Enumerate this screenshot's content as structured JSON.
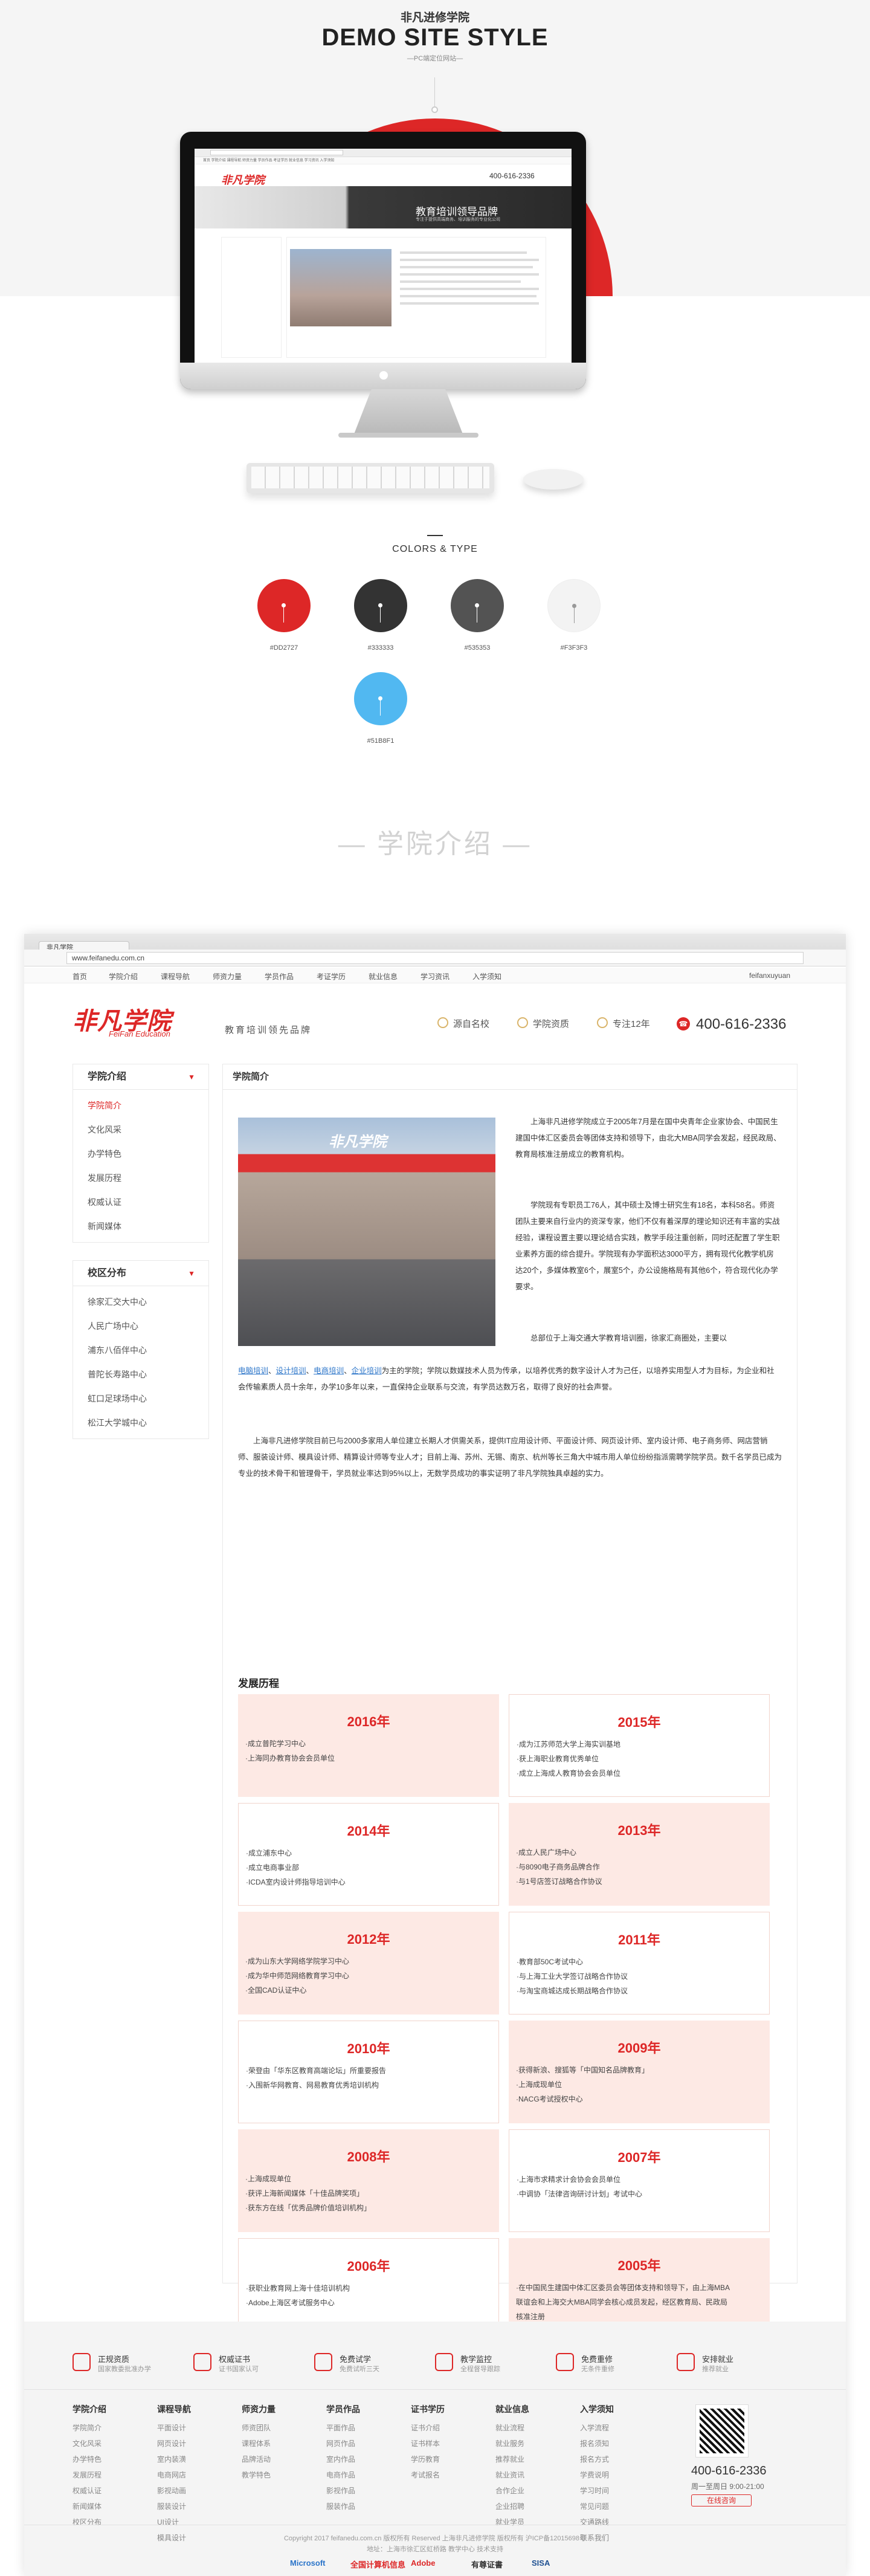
{
  "hero": {
    "subtitle": "非凡进修学院",
    "title": "DEMO SITE STYLE",
    "tag": "—PC端定位网站—"
  },
  "mini_site": {
    "logo": "非凡学院",
    "phone": "400-616-2336",
    "banner_title": "教育培训领导品牌",
    "banner_sub": "专注于提供高端商务、培训服务的专业化公司",
    "nav": "首页   学院介绍   课程导航   师资力量   学员作品   考证学历   就业信息   学习资讯   入学须知"
  },
  "colors": {
    "title": "COLORS & TYPE",
    "items": [
      {
        "hex": "#DD2727",
        "label": "#DD2727"
      },
      {
        "hex": "#333333",
        "label": "#333333"
      },
      {
        "hex": "#535353",
        "label": "#535353"
      },
      {
        "hex": "#F3F3F3",
        "label": "#F3F3F3"
      },
      {
        "hex": "#51B8F1",
        "label": "#51B8F1"
      }
    ]
  },
  "section_title": "— 学院介绍 —",
  "site": {
    "tab_title": "非凡学院",
    "url": "www.feifanedu.com.cn",
    "topnav": [
      "首页",
      "学院介绍",
      "课程导航",
      "师资力量",
      "学员作品",
      "考证学历",
      "就业信息",
      "学习资讯",
      "入学须知"
    ],
    "login_user": "feifanxuyuan",
    "logo": "非凡学院",
    "logo_en": "FeiFan Education",
    "slogan": "教育培训领先品牌",
    "header_items": [
      "源自名校",
      "学院资质",
      "专注12年"
    ],
    "phone": "400-616-2336",
    "sidebar": {
      "intro_title": "学院介绍",
      "intro_items": [
        "学院简介",
        "文化风采",
        "办学特色",
        "发展历程",
        "权威认证",
        "新闻媒体"
      ],
      "campus_title": "校区分布",
      "campus_items": [
        "徐家汇交大中心",
        "人民广场中心",
        "浦东八佰伴中心",
        "普陀长寿路中心",
        "虹口足球场中心",
        "松江大学城中心"
      ]
    },
    "main_title": "学院简介",
    "photo_sign": "非凡学院",
    "intro_p1": "上海非凡进修学院成立于2005年7月是在国中央青年企业家协会、中国民生建国中体汇区委员会等团体支持和领导下，由北大MBA同学会发起，经民政局、教育局核准注册成立的教育机构。",
    "intro_p2": "学院现有专职员工76人，其中硕士及博士研究生有18名，本科58名。师资团队主要来自行业内的资深专家，他们不仅有着深厚的理论知识还有丰富的实战经验，课程设置主要以理论结合实践，教学手段注重创新，同时还配置了学生职业素养方面的综合提升。学院现有办学面积达3000平方，拥有现代化教学机房达20个，多媒体教室6个，展室5个，办公设施格局有其他6个，符合现代化办学要求。",
    "intro_p3_pre": "总部位于上海交通大学教育培训圈，徐家汇商圈处，主要以",
    "intro_links": [
      "电脑培训",
      "设计培训",
      "电商培训",
      "企业培训"
    ],
    "intro_p3_post": "为主的学院；学院以数媒技术人员为传承，以培养优秀的数字设计人才为己任，以培养实用型人才为目标，为企业和社会传输素质人员十余年，办学10多年以来，一直保持企业联系与交流，有学员达数万名，取得了良好的社会声誉。",
    "intro_p4": "上海非凡进修学院目前已与2000多家用人单位建立长期人才供需关系，提供IT应用设计师、平面设计师、网页设计师、室内设计师、电子商务师、网店营销师、服装设计师、模具设计师、精算设计师等专业人才；目前上海、苏州、无锡、南京、杭州等长三角大中城市用人单位纷纷指派需聘学院学员。数千名学员已成为专业的技术骨干和管理骨干，学员就业率达到95%以上，无数学员成功的事实证明了非凡学院独具卓越的实力。",
    "dev_title": "发展历程",
    "dev": [
      {
        "year": "2016年",
        "lines": [
          "·成立普陀学习中心",
          "·上海同办教育协会会员单位"
        ]
      },
      {
        "year": "2015年",
        "lines": [
          "·成为江苏师范大学上海实训基地",
          "·获上海职业教育优秀单位",
          "·成立上海成人教育协会会员单位"
        ]
      },
      {
        "year": "2014年",
        "lines": [
          "·成立浦东中心",
          "·成立电商事业部",
          "·ICDA室内设计师指导培训中心"
        ]
      },
      {
        "year": "2013年",
        "lines": [
          "·成立人民广场中心",
          "·与8090电子商务品牌合作",
          "·与1号店签订战略合作协议"
        ]
      },
      {
        "year": "2012年",
        "lines": [
          "·成为山东大学网络学院学习中心",
          "·成为华中师范网络教育学习中心",
          "·全国CAD认证中心"
        ]
      },
      {
        "year": "2011年",
        "lines": [
          "·教育部50C考试中心",
          "·与上海工业大学签订战略合作协议",
          "·与淘宝商城达成长期战略合作协议"
        ]
      },
      {
        "year": "2010年",
        "lines": [
          "·荣登由「华东区教育高端论坛」所重要报告",
          "·入围新华网教育、网易教育优秀培训机构"
        ]
      },
      {
        "year": "2009年",
        "lines": [
          "·获得新浪、搜狐等「中国知名品牌教育」",
          "·上海成现单位",
          "·NACG考试授权中心"
        ]
      },
      {
        "year": "2008年",
        "lines": [
          "·上海成现单位",
          "·获评上海新闻媒体「十佳品牌奖项」",
          "·获东方在线「优秀品牌价值培训机构」"
        ]
      },
      {
        "year": "2007年",
        "lines": [
          "·上海市求精求计会协会会员单位",
          "·中调协「法律咨询研讨计划」考试中心"
        ]
      },
      {
        "year": "2006年",
        "lines": [
          "·获职业教育网上海十佳培训机构",
          "·Adobe上海区考试服务中心"
        ]
      },
      {
        "year": "2005年",
        "lines": [
          "·在中国民生建国中体汇区委员会等团体支持和领导下，由上海MBA",
          "联谊会和上海交大MBA同学会核心成员发起，经区教育局、民政局",
          "核准注册"
        ]
      }
    ],
    "footer": {
      "badges": [
        {
          "t1": "正规资质",
          "t2": "国家教委批准办学"
        },
        {
          "t1": "权威证书",
          "t2": "证书国家认可"
        },
        {
          "t1": "免费试学",
          "t2": "免费试听三天"
        },
        {
          "t1": "教学监控",
          "t2": "全程督导跟踪"
        },
        {
          "t1": "免费重修",
          "t2": "无条件重修"
        },
        {
          "t1": "安排就业",
          "t2": "推荐就业"
        }
      ],
      "cols": [
        {
          "h": "学院介绍",
          "items": [
            "学院简介",
            "文化风采",
            "办学特色",
            "发展历程",
            "权威认证",
            "新闻媒体",
            "校区分布"
          ]
        },
        {
          "h": "课程导航",
          "items": [
            "平面设计",
            "网页设计",
            "室内装潢",
            "电商网店",
            "影视动画",
            "服装设计",
            "UI设计",
            "模具设计"
          ]
        },
        {
          "h": "师资力量",
          "items": [
            "师资团队",
            "课程体系",
            "品牌活动",
            "教学特色"
          ]
        },
        {
          "h": "学员作品",
          "items": [
            "平面作品",
            "网页作品",
            "室内作品",
            "电商作品",
            "影视作品",
            "服装作品"
          ]
        },
        {
          "h": "证书学历",
          "items": [
            "证书介绍",
            "证书样本",
            "学历教育",
            "考试报名"
          ]
        },
        {
          "h": "就业信息",
          "items": [
            "就业流程",
            "就业服务",
            "推荐就业",
            "就业资讯",
            "合作企业",
            "企业招聘",
            "就业学员"
          ]
        },
        {
          "h": "入学须知",
          "items": [
            "入学流程",
            "报名须知",
            "报名方式",
            "学费说明",
            "学习时间",
            "常见问题",
            "交通路线",
            "联系我们"
          ]
        }
      ],
      "phone": "400-616-2336",
      "time": "周一至周日 9:00-21:00",
      "online": "在线咨询",
      "copy1": "Copyright 2017 feifanedu.com.cn 版权所有 Reserved 上海非凡进修学院 版权所有 沪ICP备12015698号",
      "copy2": "地址：上海市徐汇区虹桥路 教学中心 技术支持",
      "certs": [
        "Microsoft",
        "全国计算机信息",
        "Adobe",
        "有尊证書",
        "SISA"
      ]
    }
  }
}
